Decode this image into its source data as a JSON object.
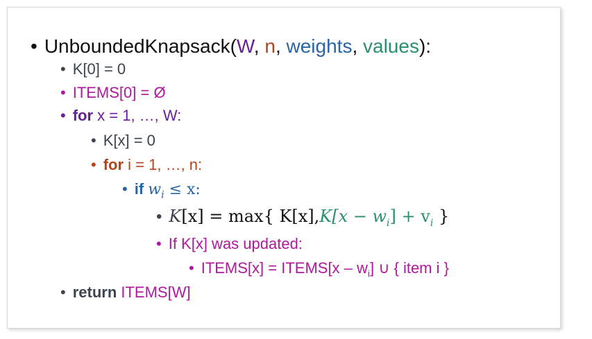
{
  "colors": {
    "black": "#111111",
    "gray": "#3d4450",
    "magenta": "#b0189e",
    "purple": "#6a1f9a",
    "orange": "#b5441b",
    "blue": "#2a64a8",
    "green": "#2a8f6e"
  },
  "bullet": "•",
  "header": {
    "fn": "UnboundedKnapsack(",
    "p1": "W",
    "c1": ", ",
    "p2": "n",
    "c2": ", ",
    "p3": "weights",
    "c3": ", ",
    "p4": "values",
    "end": "):"
  },
  "lines": {
    "k0": "K[0] = 0",
    "items0": "ITEMS[0] = Ø",
    "for_kw": "for",
    "for_x": " x = 1, …, W:",
    "kx": "K[x] = 0",
    "for_i": " i = 1, …, n:",
    "if_kw": "if",
    "if_w": "w",
    "if_i": "i",
    "if_le": " ≤ x:",
    "upd_k": "K",
    "upd_rest": "[x] = max{ K[x],",
    "upd_green": "K[x − w",
    "upd_close": "] + v",
    "upd_end": " }",
    "if_updated": "If K[x] was updated:",
    "items_set_a": "ITEMS[x] = ITEMS[x – w",
    "items_set_sub": "i",
    "items_set_b": "] ∪ { item i }",
    "return_kw": "return",
    "return_val": " ITEMS[W]"
  }
}
